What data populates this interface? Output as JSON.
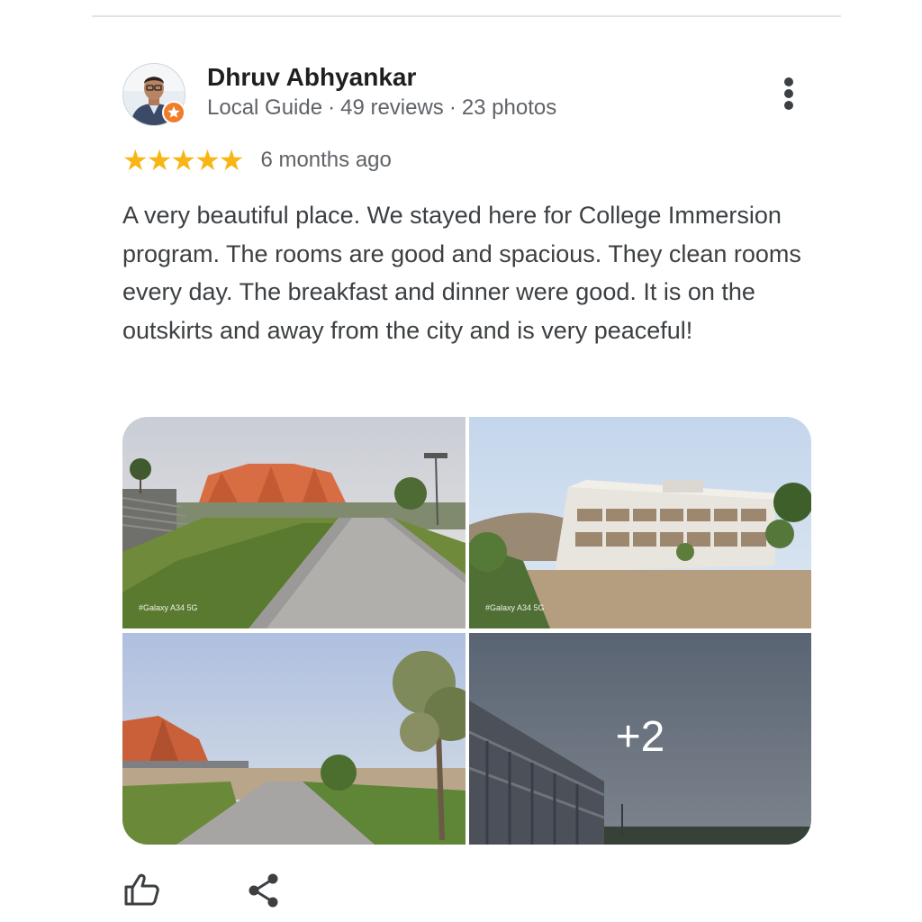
{
  "review": {
    "author": {
      "name": "Dhruv Abhyankar",
      "badge": "Local Guide",
      "reviews": "49 reviews",
      "photos": "23 photos",
      "separator": "·"
    },
    "rating": {
      "stars": 5,
      "max": 5,
      "star_glyph": "★",
      "star_color": "#f9b514"
    },
    "date": "6 months ago",
    "text": "A very beautiful place. We stayed here for College Immersion program. The rooms are good and spacious. They clean rooms every day. The breakfast and dinner were good. It is on the outskirts and away from the city and is very peaceful!",
    "photos": {
      "watermark": "#Galaxy A34 5G",
      "more_count": "+2"
    },
    "actions": {
      "like_icon": "thumbs-up-icon",
      "share_icon": "share-icon",
      "more_icon": "more-vert-icon"
    },
    "colors": {
      "accent_badge": "#ef7d2a",
      "text_secondary": "#5f6368"
    }
  }
}
